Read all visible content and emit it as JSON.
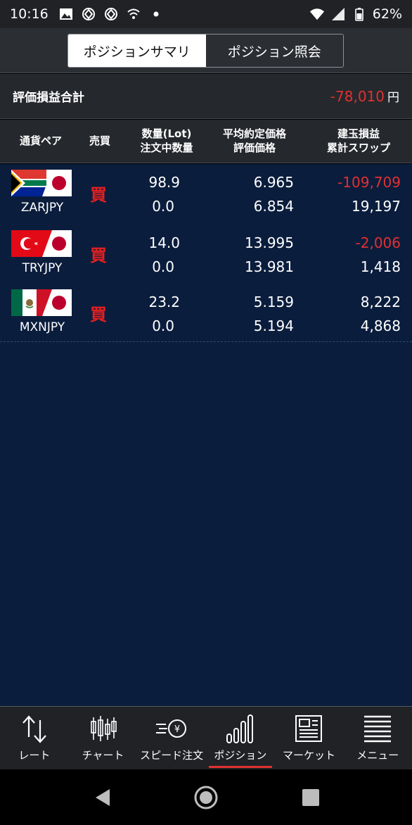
{
  "status_bar": {
    "time": "10:16",
    "battery": "62%"
  },
  "tabs": [
    {
      "label": "ポジションサマリ",
      "active": true
    },
    {
      "label": "ポジション照会",
      "active": false
    }
  ],
  "summary": {
    "label": "評価損益合計",
    "value": "-78,010",
    "unit": "円"
  },
  "columns": {
    "pair": "通貨ペア",
    "side": "売買",
    "qty_line1": "数量(Lot)",
    "qty_line2": "注文中数量",
    "price_line1": "平均約定価格",
    "price_line2": "評価価格",
    "pl_line1": "建玉損益",
    "pl_line2": "累計スワップ"
  },
  "positions": [
    {
      "flag": "south-africa-japan-flag-icon",
      "pair": "ZARJPY",
      "side": "買",
      "qty": "98.9",
      "pending_qty": "0.0",
      "avg_price": "6.965",
      "eval_price": "6.854",
      "pl": "-109,709",
      "swap": "19,197"
    },
    {
      "flag": "turkey-japan-flag-icon",
      "pair": "TRYJPY",
      "side": "買",
      "qty": "14.0",
      "pending_qty": "0.0",
      "avg_price": "13.995",
      "eval_price": "13.981",
      "pl": "-2,006",
      "swap": "1,418"
    },
    {
      "flag": "mexico-japan-flag-icon",
      "pair": "MXNJPY",
      "side": "買",
      "qty": "23.2",
      "pending_qty": "0.0",
      "avg_price": "5.159",
      "eval_price": "5.194",
      "pl": "8,222",
      "swap": "4,868"
    }
  ],
  "bottom_nav": [
    {
      "label": "レート",
      "icon": "rate-arrows-icon",
      "active": false
    },
    {
      "label": "チャート",
      "icon": "candlestick-chart-icon",
      "active": false
    },
    {
      "label": "スピード注文",
      "icon": "speed-order-icon",
      "active": false
    },
    {
      "label": "ポジション",
      "icon": "position-bars-icon",
      "active": true
    },
    {
      "label": "マーケット",
      "icon": "market-news-icon",
      "active": false
    },
    {
      "label": "メニュー",
      "icon": "menu-lines-icon",
      "active": false
    }
  ],
  "colors": {
    "negative": "#e03131",
    "list_bg": "#0b1d3d",
    "accent": "#e03131"
  }
}
